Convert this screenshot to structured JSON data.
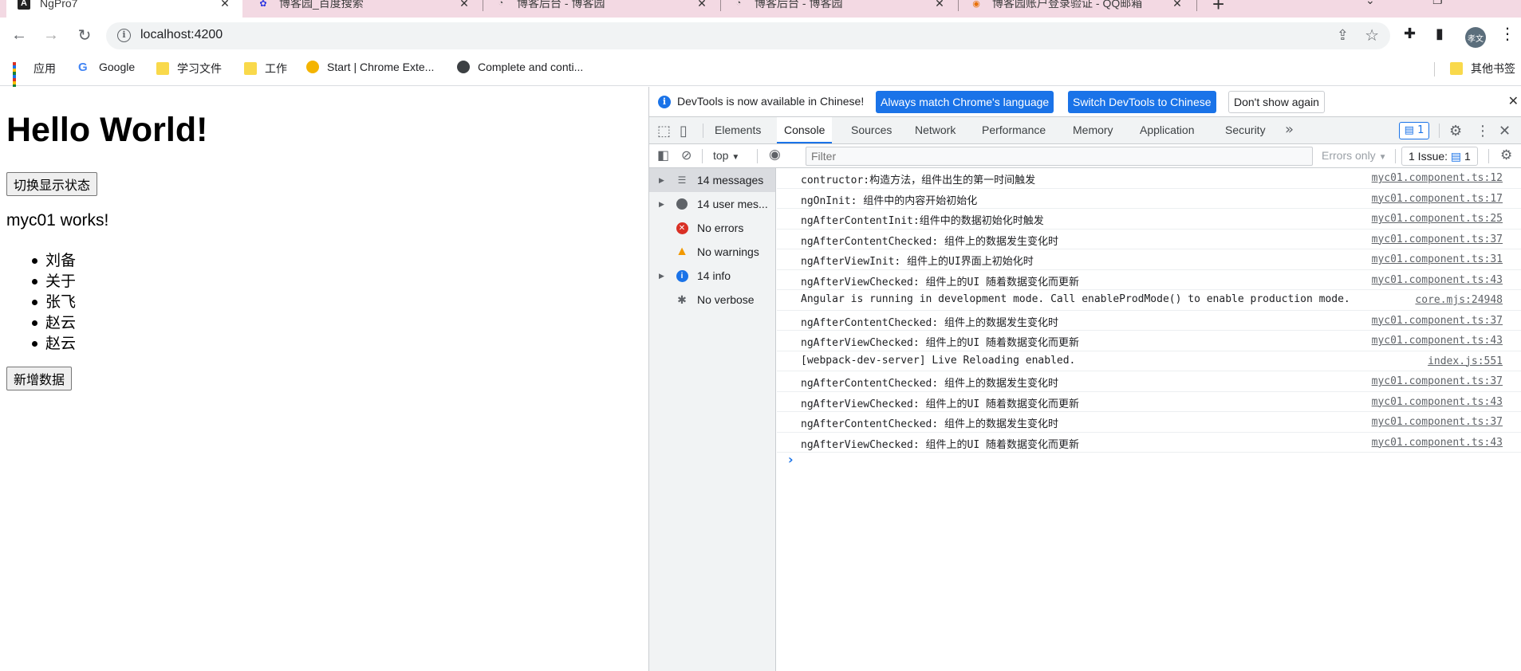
{
  "browser": {
    "tabs": [
      {
        "title": "NgPro7",
        "active": true
      },
      {
        "title": "博客园_百度搜索",
        "active": false
      },
      {
        "title": "博客后台 - 博客园",
        "active": false
      },
      {
        "title": "博客后台 - 博客园",
        "active": false
      },
      {
        "title": "博客园账户登录验证 - QQ邮箱",
        "active": false
      }
    ],
    "new_tab": "+",
    "url": "localhost:4200",
    "avatar_label": "孝文",
    "bookmarks": [
      {
        "label": "应用",
        "icon": "apps-icon"
      },
      {
        "label": "Google",
        "icon": "google-icon"
      },
      {
        "label": "学习文件",
        "icon": "folder-icon"
      },
      {
        "label": "工作",
        "icon": "folder-icon"
      },
      {
        "label": "Start | Chrome Exte...",
        "icon": "smiley-icon"
      },
      {
        "label": "Complete and conti...",
        "icon": "globe-icon"
      }
    ],
    "other_bookmarks": "其他书签"
  },
  "page": {
    "heading": "Hello World!",
    "toggle_button": "切换显示状态",
    "component_text": "myc01 works!",
    "items": [
      "刘备",
      "关于",
      "张飞",
      "赵云",
      "赵云"
    ],
    "add_button": "新增数据"
  },
  "devtools": {
    "infobar": {
      "message": "DevTools is now available in Chinese!",
      "match_button": "Always match Chrome's language",
      "switch_button": "Switch DevTools to Chinese",
      "dismiss_button": "Don't show again"
    },
    "tabs": [
      "Elements",
      "Console",
      "Sources",
      "Network",
      "Performance",
      "Memory",
      "Application",
      "Security"
    ],
    "active_tab": "Console",
    "issues_badge": "1",
    "console_toolbar": {
      "context": "top",
      "filter_placeholder": "Filter",
      "levels": "Errors only",
      "issues_label": "1 Issue:",
      "issues_count": "1"
    },
    "sidebar": [
      {
        "label": "14 messages",
        "icon": "list-icon",
        "expandable": true,
        "selected": true
      },
      {
        "label": "14 user mes...",
        "icon": "user-icon",
        "expandable": true,
        "selected": false
      },
      {
        "label": "No errors",
        "icon": "error-icon",
        "expandable": false,
        "selected": false
      },
      {
        "label": "No warnings",
        "icon": "warning-icon",
        "expandable": false,
        "selected": false
      },
      {
        "label": "14 info",
        "icon": "info-icon",
        "expandable": true,
        "selected": false
      },
      {
        "label": "No verbose",
        "icon": "verbose-icon",
        "expandable": false,
        "selected": false
      }
    ],
    "logs": [
      {
        "msg": "contructor:构造方法，组件出生的第一时间触发",
        "src": "myc01.component.ts:12"
      },
      {
        "msg": "ngOnInit: 组件中的内容开始初始化",
        "src": "myc01.component.ts:17"
      },
      {
        "msg": "ngAfterContentInit:组件中的数据初始化时触发",
        "src": "myc01.component.ts:25"
      },
      {
        "msg": "ngAfterContentChecked: 组件上的数据发生变化时",
        "src": "myc01.component.ts:37"
      },
      {
        "msg": "ngAfterViewInit: 组件上的UI界面上初始化时",
        "src": "myc01.component.ts:31"
      },
      {
        "msg": "ngAfterViewChecked: 组件上的UI 随着数据变化而更新",
        "src": "myc01.component.ts:43"
      },
      {
        "msg": "Angular is running in development mode. Call enableProdMode() to enable production mode.",
        "src": "core.mjs:24948"
      },
      {
        "msg": "ngAfterContentChecked: 组件上的数据发生变化时",
        "src": "myc01.component.ts:37"
      },
      {
        "msg": "ngAfterViewChecked: 组件上的UI 随着数据变化而更新",
        "src": "myc01.component.ts:43"
      },
      {
        "msg": "[webpack-dev-server] Live Reloading enabled.",
        "src": "index.js:551"
      },
      {
        "msg": "ngAfterContentChecked: 组件上的数据发生变化时",
        "src": "myc01.component.ts:37"
      },
      {
        "msg": "ngAfterViewChecked: 组件上的UI 随着数据变化而更新",
        "src": "myc01.component.ts:43"
      },
      {
        "msg": "ngAfterContentChecked: 组件上的数据发生变化时",
        "src": "myc01.component.ts:37"
      },
      {
        "msg": "ngAfterViewChecked: 组件上的UI 随着数据变化而更新",
        "src": "myc01.component.ts:43"
      }
    ],
    "prompt": "›"
  }
}
